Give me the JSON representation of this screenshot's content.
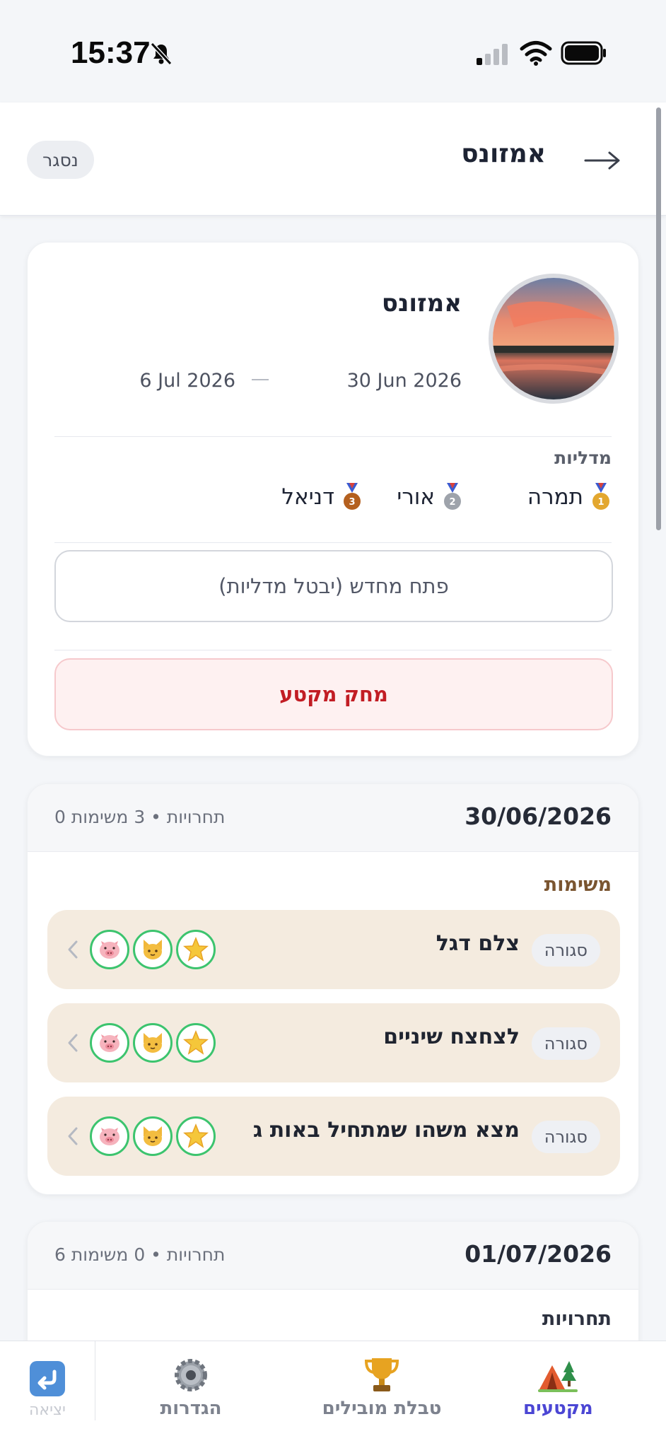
{
  "status_bar": {
    "time": "15:37"
  },
  "header": {
    "close_label": "נסגר",
    "title": "אמזונס"
  },
  "event": {
    "name": "אמזונס",
    "start_date": "30 Jun 2026",
    "end_date": "6 Jul 2026",
    "medals_title": "מדליות",
    "medals": [
      {
        "place": 1,
        "name": "תמרה",
        "color": "#e3a72f"
      },
      {
        "place": 2,
        "name": "אורי",
        "color": "#9ea3ab"
      },
      {
        "place": 3,
        "name": "דניאל",
        "color": "#b4601f"
      }
    ],
    "reopen_label": "פתח מחדש (יבטל מדליות)",
    "delete_label": "מחק מקטע"
  },
  "days": [
    {
      "date": "30/06/2026",
      "summary": "0 תחרויות • 3 משימות",
      "section_label": "משימות",
      "missions": [
        {
          "status": "סגורה",
          "title": "צלם דגל"
        },
        {
          "status": "סגורה",
          "title": "לצחצח שיניים"
        },
        {
          "status": "סגורה",
          "title": "מצא משהו שמתחיל באות ג"
        }
      ]
    },
    {
      "date": "01/07/2026",
      "summary": "6 תחרויות • 0 משימות",
      "section_label": "תחרויות"
    }
  ],
  "tabs": [
    {
      "label": "יציאה",
      "icon": "exit-icon"
    },
    {
      "label": "הגדרות",
      "icon": "gear-icon"
    },
    {
      "label": "טבלת מובילים",
      "icon": "trophy-icon"
    },
    {
      "label": "מקטעים",
      "icon": "tent-icon",
      "active": true
    }
  ],
  "colors": {
    "accent": "#4b46d4",
    "danger": "#c21d24",
    "mission_bg": "#f4ebdf",
    "player_ring": "#3cc46e"
  }
}
